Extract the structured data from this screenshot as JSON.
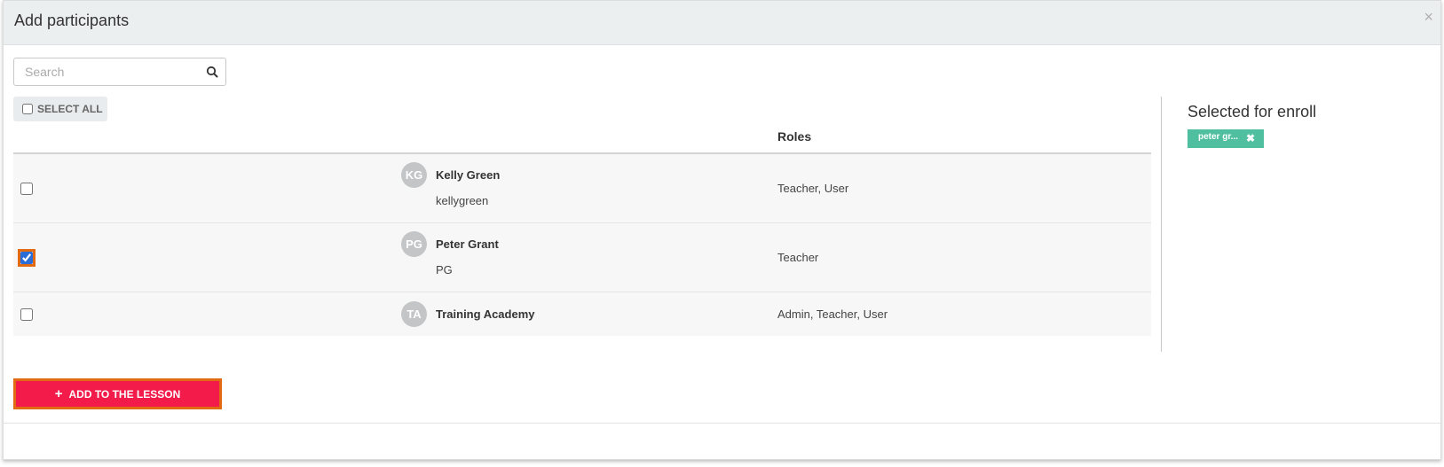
{
  "modal": {
    "title": "Add participants",
    "close_symbol": "×"
  },
  "search": {
    "placeholder": "Search",
    "value": ""
  },
  "select_all": {
    "label": "SELECT ALL",
    "checked": false
  },
  "table": {
    "columns": [
      "",
      "",
      "Roles"
    ],
    "rows": [
      {
        "initials": "KG",
        "name": "Kelly Green",
        "username": "kellygreen",
        "roles": "Teacher, User",
        "checked": false
      },
      {
        "initials": "PG",
        "name": "Peter Grant",
        "username": "PG",
        "roles": "Teacher",
        "checked": true
      },
      {
        "initials": "TA",
        "name": "Training Academy",
        "username": "",
        "roles": "Admin, Teacher, User",
        "checked": false
      }
    ]
  },
  "selected_panel": {
    "title": "Selected for enroll",
    "chips": [
      {
        "label": "peter gr...",
        "remove_symbol": "✖"
      }
    ]
  },
  "add_button": {
    "icon": "+",
    "label": "ADD TO THE LESSON"
  },
  "colors": {
    "header_bg": "#eceff0",
    "accent_red": "#f21b4a",
    "chip_green": "#4fbf9f",
    "focus_orange": "#e26a13"
  }
}
